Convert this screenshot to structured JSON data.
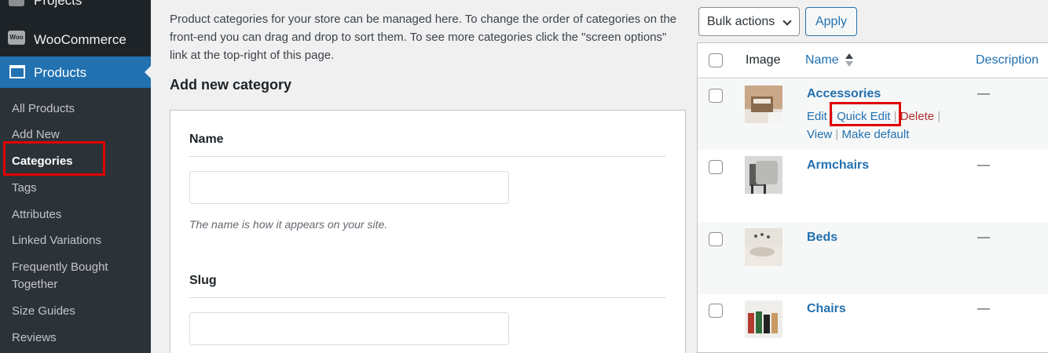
{
  "sidebar": {
    "top_item": "Projects",
    "woocommerce": {
      "icon": "woo-logo-icon",
      "label": "WooCommerce",
      "icon_text": "Woo"
    },
    "products": {
      "icon": "archive-icon",
      "label": "Products"
    },
    "submenu": [
      "All Products",
      "Add New",
      "Categories",
      "Tags",
      "Attributes",
      "Linked Variations",
      "Frequently Bought Together",
      "Size Guides",
      "Reviews"
    ]
  },
  "main": {
    "intro": "Product categories for your store can be managed here. To change the order of categories on the front-end you can drag and drop to sort them. To see more categories click the \"screen options\" link at the top-right of this page.",
    "add_heading": "Add new category",
    "form": {
      "name_label": "Name",
      "name_value": "",
      "name_help": "The name is how it appears on your site.",
      "slug_label": "Slug",
      "slug_value": ""
    }
  },
  "list": {
    "bulk_actions": "Bulk actions",
    "apply": "Apply",
    "columns": {
      "image": "Image",
      "name": "Name",
      "description": "Description"
    },
    "rows": [
      {
        "name": "Accessories",
        "description": "—"
      },
      {
        "name": "Armchairs",
        "description": "—"
      },
      {
        "name": "Beds",
        "description": "—"
      },
      {
        "name": "Chairs",
        "description": "—"
      }
    ],
    "row_actions": {
      "edit": "Edit",
      "quick_edit": "Quick Edit",
      "delete": "Delete",
      "view": "View",
      "make_default": "Make default",
      "sep": "|"
    }
  },
  "colors": {
    "sidebar": "#1d2327",
    "submenu": "#2c3338",
    "active": "#2271b1",
    "highlight": "#e00000",
    "delete": "#b32d2e"
  }
}
